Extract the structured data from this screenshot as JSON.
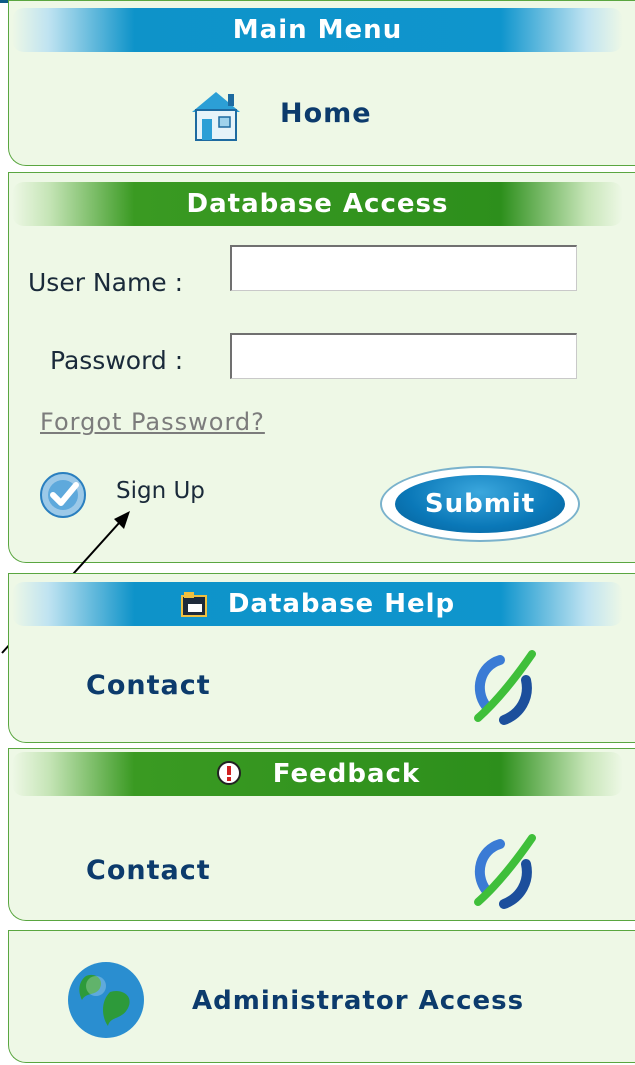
{
  "main_menu": {
    "title": "Main Menu",
    "home_label": "Home"
  },
  "database_access": {
    "title": "Database Access",
    "username_label": "User Name :",
    "username_value": "",
    "password_label": "Password :",
    "password_value": "",
    "forgot_link": "Forgot Password?",
    "signup_label": "Sign Up",
    "submit_label": "Submit"
  },
  "database_help": {
    "title": "Database Help",
    "contact_label": "Contact"
  },
  "feedback": {
    "title": "Feedback",
    "contact_label": "Contact"
  },
  "admin": {
    "label": "Administrator Access"
  },
  "colors": {
    "panel_bg": "#eef8e6",
    "panel_border": "#5aa640",
    "blue_bar": "#0f95cd",
    "green_bar": "#2d8f1c",
    "navy_text": "#0c3b6c"
  }
}
